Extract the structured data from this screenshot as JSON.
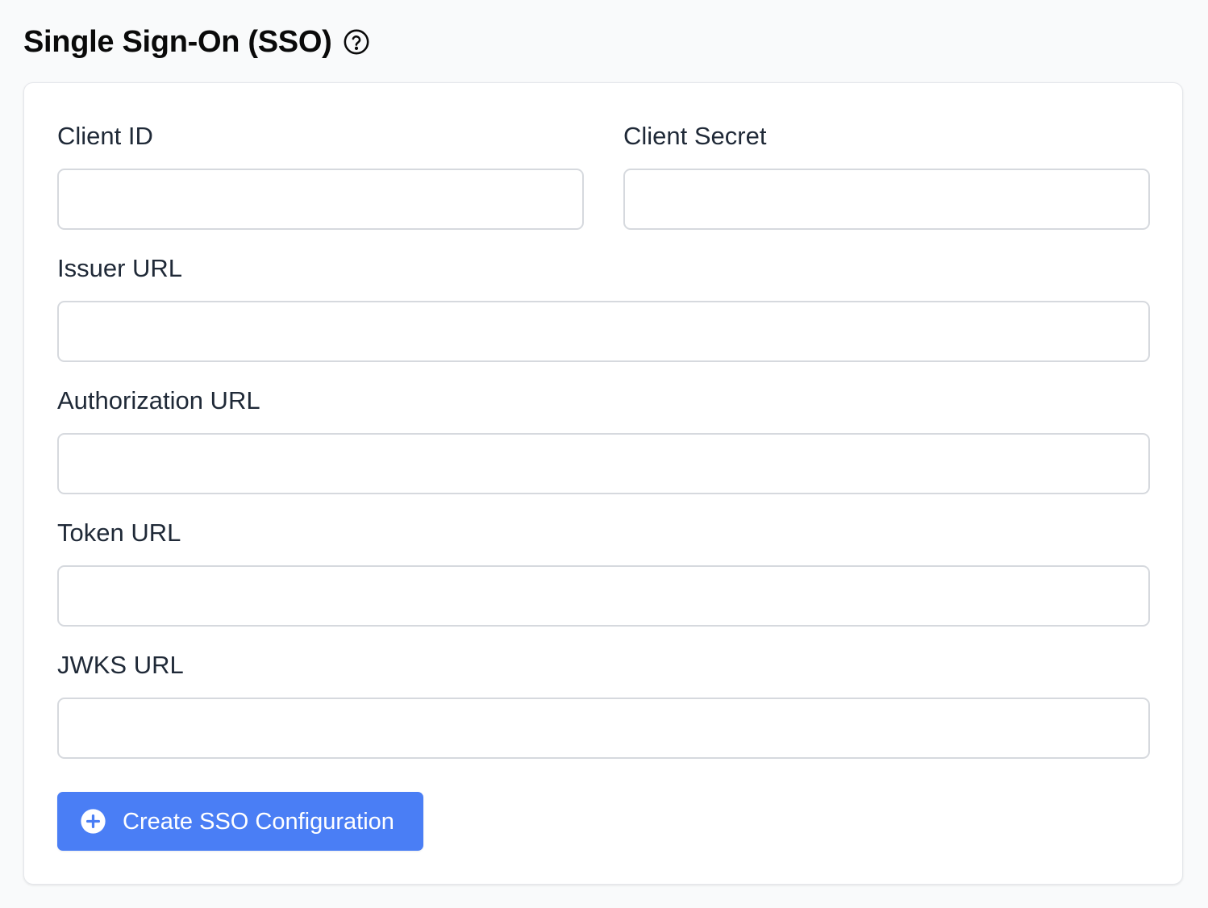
{
  "header": {
    "title": "Single Sign-On (SSO)",
    "help_icon": "question-circle-icon"
  },
  "form": {
    "fields": [
      {
        "id": "client_id",
        "label": "Client ID",
        "value": "",
        "placeholder": ""
      },
      {
        "id": "client_secret",
        "label": "Client Secret",
        "value": "",
        "placeholder": ""
      },
      {
        "id": "issuer_url",
        "label": "Issuer URL",
        "value": "",
        "placeholder": ""
      },
      {
        "id": "authorization_url",
        "label": "Authorization URL",
        "value": "",
        "placeholder": ""
      },
      {
        "id": "token_url",
        "label": "Token URL",
        "value": "",
        "placeholder": ""
      },
      {
        "id": "jwks_url",
        "label": "JWKS URL",
        "value": "",
        "placeholder": ""
      }
    ],
    "submit": {
      "label": "Create SSO Configuration",
      "icon": "plus-circle-icon"
    }
  },
  "colors": {
    "accent": "#4a7ef5",
    "background": "#f9fafb",
    "card": "#ffffff",
    "input_border": "#d6d9de",
    "text": "#1f2937"
  }
}
